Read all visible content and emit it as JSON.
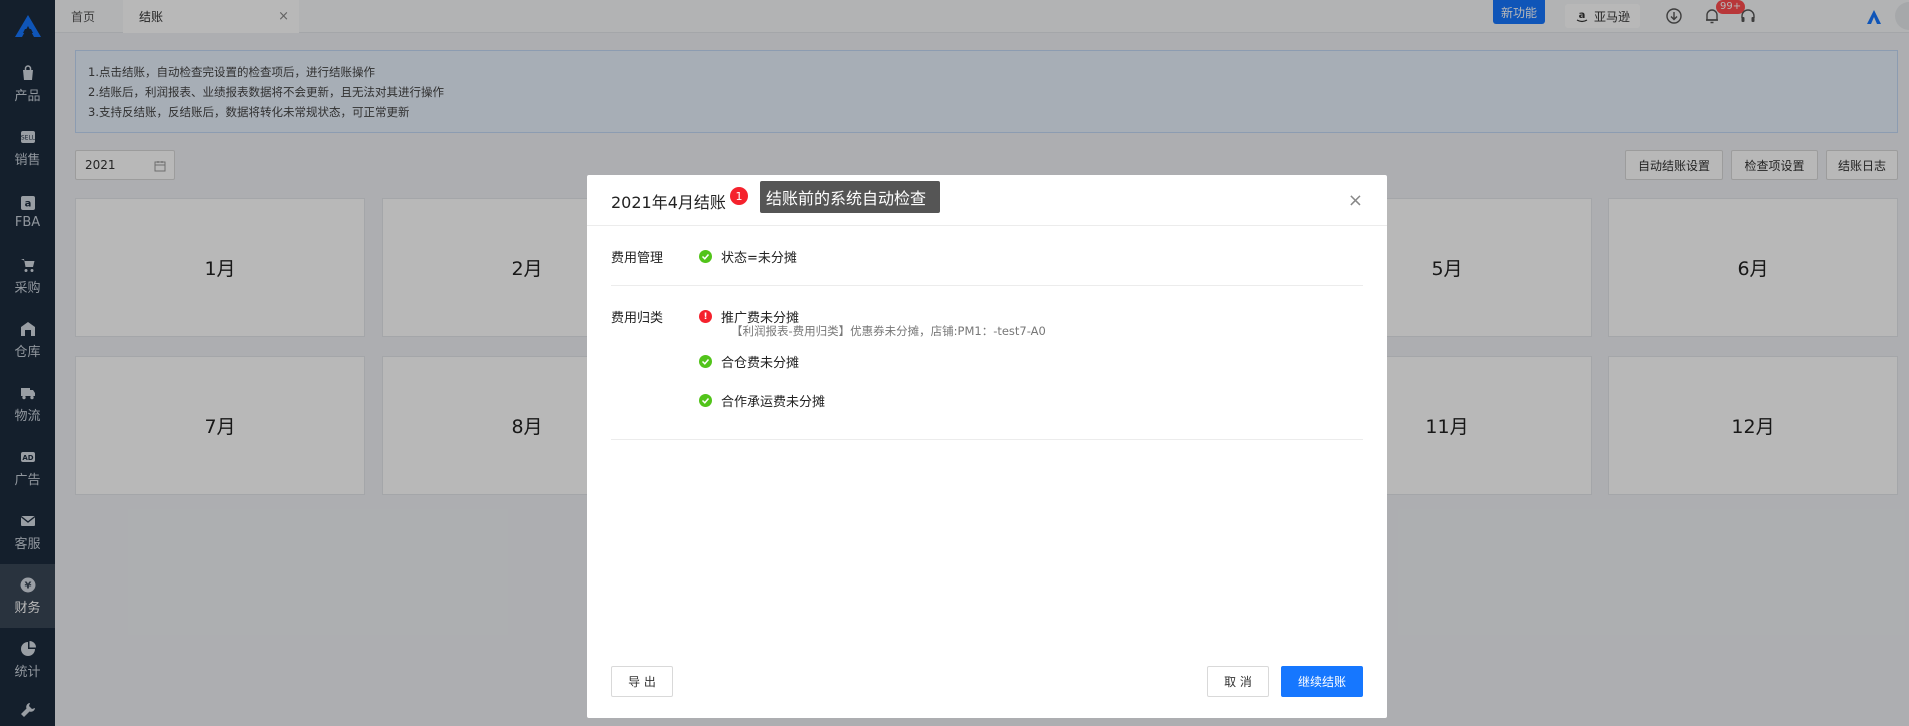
{
  "sidebar": {
    "items": [
      {
        "label": "产品",
        "icon": "bag-icon"
      },
      {
        "label": "销售",
        "icon": "sell-icon"
      },
      {
        "label": "FBA",
        "icon": "amazon-icon"
      },
      {
        "label": "采购",
        "icon": "cart-icon"
      },
      {
        "label": "仓库",
        "icon": "warehouse-icon"
      },
      {
        "label": "物流",
        "icon": "truck-icon"
      },
      {
        "label": "广告",
        "icon": "ad-icon"
      },
      {
        "label": "客服",
        "icon": "mail-icon"
      },
      {
        "label": "财务",
        "icon": "yen-icon"
      },
      {
        "label": "统计",
        "icon": "pie-icon"
      }
    ],
    "active": "财务"
  },
  "tabs": {
    "home": "首页",
    "active": "结账",
    "close_glyph": "×"
  },
  "topbar": {
    "new_feature": "新功能",
    "amazon": "亚马逊",
    "notifications_badge": "99+"
  },
  "notice": {
    "lines": [
      "1.点击结账，自动检查完设置的检查项后，进行结账操作",
      "2.结账后，利润报表、业绩报表数据将不会更新，且无法对其进行操作",
      "3.支持反结账，反结账后，数据将转化未常规状态，可正常更新"
    ]
  },
  "toolbar": {
    "year": "2021",
    "auto_settings": "自动结账设置",
    "check_settings": "检查项设置",
    "log": "结账日志"
  },
  "months": [
    "1月",
    "2月",
    "5月",
    "6月",
    "7月",
    "8月",
    "11月",
    "12月"
  ],
  "modal": {
    "title": "2021年4月结账",
    "err_count": "1",
    "tooltip": "结账前的系统自动检查",
    "close_glyph": "×",
    "groups": [
      {
        "label": "费用管理",
        "checks": [
          {
            "status": "ok",
            "text": "状态=未分摊"
          }
        ]
      },
      {
        "label": "费用归类",
        "checks": [
          {
            "status": "error",
            "text": "推广费未分摊",
            "detail": "【利润报表-费用归类】优惠券未分摊，店铺:PM1：-test7-A0"
          },
          {
            "status": "ok",
            "text": "合仓费未分摊"
          },
          {
            "status": "ok",
            "text": "合作承运费未分摊"
          }
        ]
      }
    ],
    "export_label": "导 出",
    "cancel_label": "取 消",
    "continue_label": "继续结账"
  },
  "colors": {
    "sidebar_bg": "#1c2b3d",
    "primary": "#1677ff",
    "ok": "#52c41a",
    "error": "#f5222d"
  }
}
